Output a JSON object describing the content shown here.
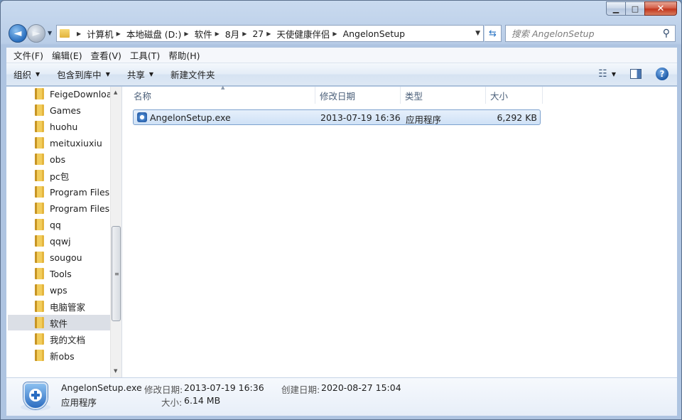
{
  "window": {
    "caption": {
      "minimize": "▁",
      "maximize": "□",
      "close": "✕"
    }
  },
  "nav": {
    "back_icon": "◄",
    "forward_icon": "►",
    "breadcrumbs": [
      "计算机",
      "本地磁盘 (D:)",
      "软件",
      "8月",
      "27",
      "天使健康伴侣",
      "AngelonSetup"
    ],
    "search_placeholder": "搜索 AngelonSetup"
  },
  "menu": [
    "文件(F)",
    "编辑(E)",
    "查看(V)",
    "工具(T)",
    "帮助(H)"
  ],
  "toolbar": {
    "organize": "组织",
    "include_library": "包含到库中",
    "share": "共享",
    "new_folder": "新建文件夹"
  },
  "tree": {
    "items": [
      "FeigeDownloa",
      "Games",
      "huohu",
      "meituxiuxiu",
      "obs",
      "pc包",
      "Program Files",
      "Program Files",
      "qq",
      "qqwj",
      "sougou",
      "Tools",
      "wps",
      "电脑管家",
      "软件",
      "我的文档",
      "新obs"
    ],
    "selected_index": 14
  },
  "columns": {
    "name": "名称",
    "modified": "修改日期",
    "type": "类型",
    "size": "大小"
  },
  "files": [
    {
      "name": "AngelonSetup.exe",
      "modified": "2013-07-19 16:36",
      "type": "应用程序",
      "size": "6,292 KB"
    }
  ],
  "details": {
    "name": "AngelonSetup.exe",
    "type": "应用程序",
    "modified_label": "修改日期:",
    "modified_value": "2013-07-19 16:36",
    "created_label": "创建日期:",
    "created_value": "2020-08-27 15:04",
    "size_label": "大小:",
    "size_value": "6.14 MB"
  },
  "colors": {
    "accent": "#2a6dc2",
    "selection": "#cfe1f6"
  }
}
